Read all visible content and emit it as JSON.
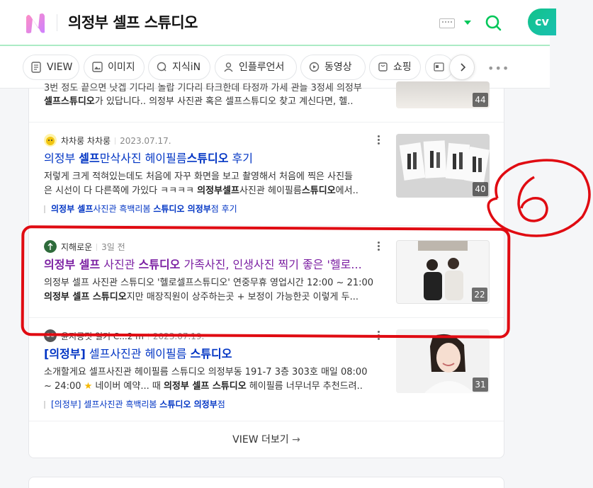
{
  "header": {
    "query": "의정부 셀프 스튜디오",
    "profile_badge": "cv"
  },
  "tabs": [
    {
      "label": "VIEW",
      "icon": "document-icon"
    },
    {
      "label": "이미지",
      "icon": "image-icon"
    },
    {
      "label": "지식iN",
      "icon": "q-icon"
    },
    {
      "label": "인플루언서",
      "icon": "person-icon"
    },
    {
      "label": "동영상",
      "icon": "play-icon"
    },
    {
      "label": "쇼핑",
      "icon": "bag-icon"
    }
  ],
  "results": [
    {
      "snippet_line1": "3번 정도 끝으면 낫겝 기다리 놀랍 기다리 타크한데 타정까 가세 관늘 3정세 의정부",
      "snippet_line2_bold": "셀프스튜디오",
      "snippet_line2_rest": "가 있답니다.. 의정부 사진관 혹은 셀프스튜디오 찾고 계신다면, 헬..",
      "image_count": "44"
    },
    {
      "author": "차차룽 차차룽",
      "date": "2023.07.17.",
      "title_a": "의정부 ",
      "title_b": "셀프",
      "title_c": "만삭사진 헤이필름",
      "title_d": "스튜디오",
      "title_e": " 후기",
      "snippet_line1": "저렇게 크게 적혀있는데도 처음에 자꾸 화면을 보고 촬영해서 처음에 찍은 사진들",
      "snippet_line2_a": "은 시선이 다 다른쪽에 가있다 ㅋㅋㅋㅋ ",
      "snippet_line2_b": "의정부셀프",
      "snippet_line2_c": "사진관 헤이필름",
      "snippet_line2_d": "스튜디오",
      "snippet_line2_e": "에서..",
      "sublink_a": "의정부 셀프",
      "sublink_b": "사진관 흑백리봄 ",
      "sublink_c": "스튜디오 의정부",
      "sublink_d": "점 후기",
      "image_count": "40"
    },
    {
      "author": "지해로운",
      "date": "3일 전",
      "title_a": "의정부 셀프",
      "title_b": " 사진관 ",
      "title_c": "스튜디오",
      "title_d": " 가족사진, 인생사진 찍기 좋은 '헬로...",
      "snippet_line1": "의정부 셀프 사진관 스튜디오 '헬로셀프스튜디오' 연중무휴 영업시간 12:00 ~ 21:00",
      "snippet_line2_a": "의정부 셀프 스튜디오",
      "snippet_line2_b": "지만 매장직원이 상주하는곳 + 보정이 가능한곳 이렇게 두...",
      "image_count": "22"
    },
    {
      "author": "윤지콩짓 일기 C...2 m",
      "date": "2023.07.19.",
      "title_a": "[의정부]",
      "title_b": " 셀프사진관 헤이필름 ",
      "title_c": "스튜디오",
      "snippet_line1": "소개할게요 셀프사진관 헤이필름 스튜디오 의정부동 191-7 3층 303호 매일 08:00",
      "snippet_line2_a": "~ 24:00 ",
      "snippet_line2_star": "★",
      "snippet_line2_b": " 네이버 예약... 때 ",
      "snippet_line2_c": "의정부 셀프 스튜디오",
      "snippet_line2_d": " 헤이필름 너무너무 추천드려..",
      "sublink_a": "[의정부]",
      "sublink_b": " 셀프사진관 흑백리봄 ",
      "sublink_c": "스튜디오 의정부",
      "sublink_d": "점",
      "image_count": "31"
    }
  ],
  "more": {
    "label": "VIEW 더보기",
    "arrow": "→"
  },
  "annotation": {
    "text": "6",
    "color": "#e00b12"
  },
  "colors": {
    "accent": "#03c75a",
    "link": "#0034c4",
    "visited": "#7b1fa2"
  }
}
